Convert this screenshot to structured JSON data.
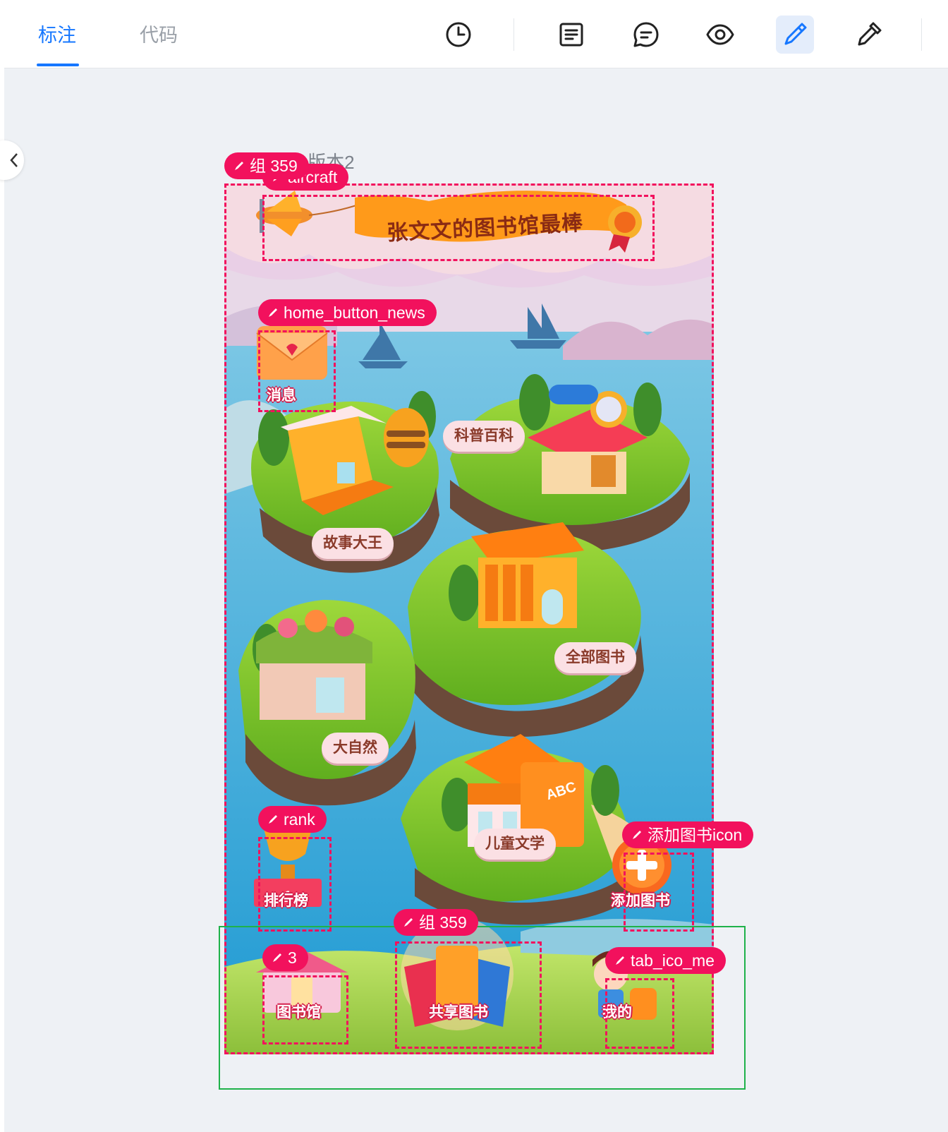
{
  "topbar": {
    "tabs": [
      {
        "label": "标注",
        "active": true
      },
      {
        "label": "代码",
        "active": false
      }
    ],
    "tools": [
      "history-icon",
      "notes-icon",
      "comment-icon",
      "preview-icon",
      "annotate-pen-icon",
      "color-picker-icon"
    ],
    "accent": "#1677ff"
  },
  "frame": {
    "title": "1 : 版本2"
  },
  "annotations": {
    "group_359_top": "组 359",
    "aircraft": "aircraft",
    "home_button_news": "home_button_news",
    "rank": "rank",
    "add_book_icon": "添加图书icon",
    "group_359_bottom": "组 359",
    "three": "3",
    "tab_ico_me": "tab_ico_me",
    "color": "#f2115d",
    "selection_color": "#1fb24a"
  },
  "design": {
    "banner_text": "张文文的图书馆最棒",
    "news_label": "消息",
    "islands": [
      "科普百科",
      "故事大王",
      "全部图书",
      "大自然",
      "儿童文学"
    ],
    "rank_label": "排行榜",
    "add_book_label": "添加图书",
    "bottom_tabs": [
      "图书馆",
      "共享图书",
      "我的"
    ],
    "abc_text": "ABC"
  }
}
